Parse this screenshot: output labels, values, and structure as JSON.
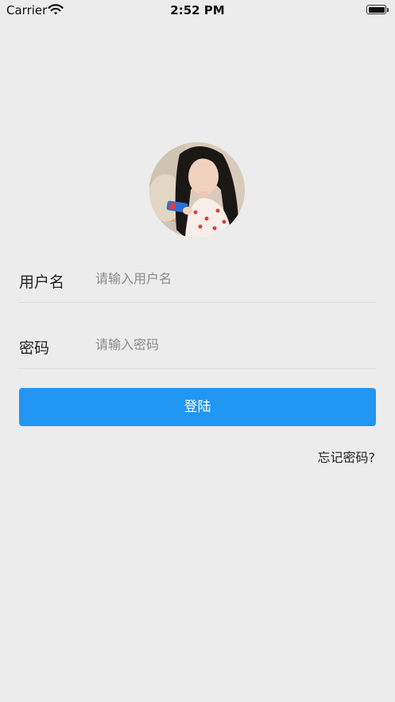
{
  "status_bar": {
    "carrier": "Carrier",
    "time": "2:52 PM",
    "wifi_icon": "wifi-icon",
    "battery_icon": "battery-icon"
  },
  "avatar": {
    "icon": "user-avatar-photo"
  },
  "username": {
    "label": "用户名",
    "placeholder": "请输入用户名",
    "value": ""
  },
  "password": {
    "label": "密码",
    "placeholder": "请输入密码",
    "value": ""
  },
  "login_button": {
    "label": "登陆",
    "color": "#2196f3"
  },
  "forgot_password": {
    "label": "忘记密码?"
  },
  "colors": {
    "background": "#ececec",
    "divider": "#dcdcdc",
    "accent": "#2196f3"
  }
}
